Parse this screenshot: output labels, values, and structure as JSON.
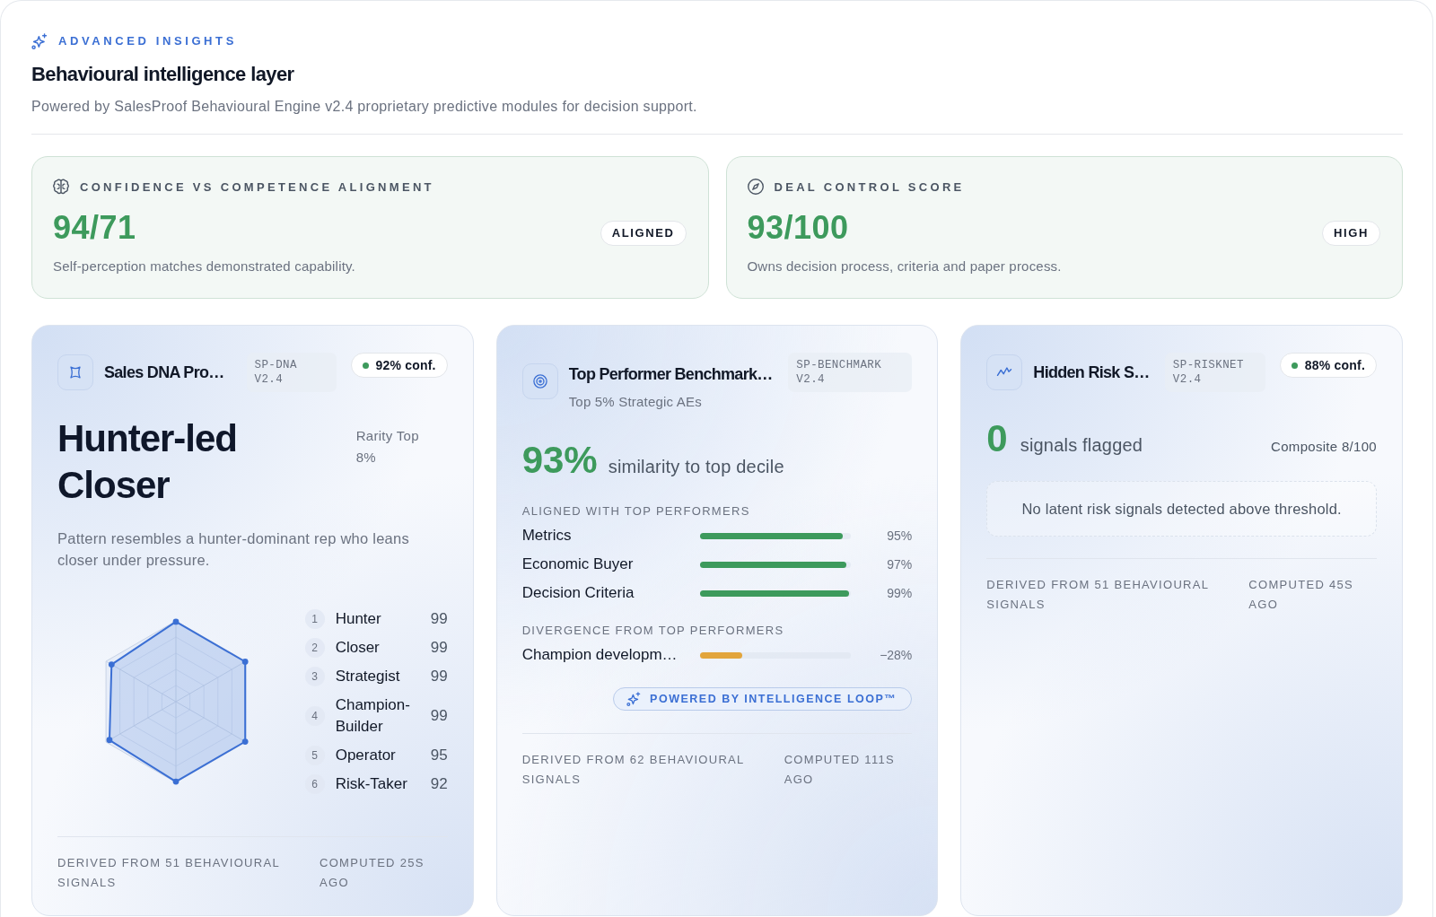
{
  "header": {
    "eyebrow": "ADVANCED INSIGHTS",
    "title": "Behavioural intelligence layer",
    "subtitle": "Powered by SalesProof Behavioural Engine v2.4 proprietary predictive modules for decision support."
  },
  "summary_cards": [
    {
      "label": "CONFIDENCE VS COMPETENCE ALIGNMENT",
      "value": "94/71",
      "description": "Self-perception matches demonstrated capability.",
      "badge": "ALIGNED"
    },
    {
      "label": "DEAL CONTROL SCORE",
      "value": "93/100",
      "description": "Owns decision process, criteria and paper process.",
      "badge": "HIGH"
    }
  ],
  "modules": [
    {
      "kind": "profile",
      "title": "Sales DNA Pro…",
      "code": "SP-DNA",
      "version": "V2.4",
      "confidence": "92% conf.",
      "headline": "Hunter-led Closer",
      "rarity": "Rarity Top 8%",
      "description": "Pattern resembles a hunter-dominant rep who leans closer under pressure.",
      "traits": [
        {
          "rank": "1",
          "name": "Hunter",
          "score": "99"
        },
        {
          "rank": "2",
          "name": "Closer",
          "score": "99"
        },
        {
          "rank": "3",
          "name": "Strategist",
          "score": "99"
        },
        {
          "rank": "4",
          "name": "Champion-Builder",
          "score": "99"
        },
        {
          "rank": "5",
          "name": "Operator",
          "score": "95"
        },
        {
          "rank": "6",
          "name": "Risk-Taker",
          "score": "92"
        }
      ],
      "derived": "DERIVED FROM 51 BEHAVIOURAL SIGNALS",
      "computed": "COMPUTED 25S AGO"
    },
    {
      "kind": "benchmark",
      "title": "Top Performer Benchmark…",
      "subtitle": "Top 5% Strategic AEs",
      "code": "SP-BENCHMARK",
      "version": "V2.4",
      "stat": "93%",
      "stat_caption": "similarity to top decile",
      "sections": [
        {
          "kind": "aligned",
          "label": "ALIGNED WITH TOP PERFORMERS",
          "rows": [
            {
              "name": "Metrics",
              "level": 0.95,
              "value": "95%"
            },
            {
              "name": "Economic Buyer",
              "level": 0.97,
              "value": "97%"
            },
            {
              "name": "Decision Criteria",
              "level": 0.99,
              "value": "99%"
            }
          ]
        },
        {
          "kind": "divergence",
          "label": "DIVERGENCE FROM TOP PERFORMERS",
          "rows": [
            {
              "name": "Champion developm…",
              "level": 0.28,
              "value": "−28%"
            }
          ]
        }
      ],
      "tag": "POWERED BY INTELLIGENCE LOOP™",
      "derived": "DERIVED FROM 62 BEHAVIOURAL SIGNALS",
      "computed": "COMPUTED 111S AGO"
    },
    {
      "kind": "risk",
      "title": "Hidden Risk S…",
      "code": "SP-RISKNET",
      "version": "V2.4",
      "confidence": "88% conf.",
      "stat": "0",
      "stat_caption": "signals flagged",
      "composite": "Composite 8/100",
      "notice": "No latent risk signals detected above threshold.",
      "derived": "DERIVED FROM 51 BEHAVIOURAL SIGNALS",
      "computed": "COMPUTED 45S AGO"
    }
  ]
}
